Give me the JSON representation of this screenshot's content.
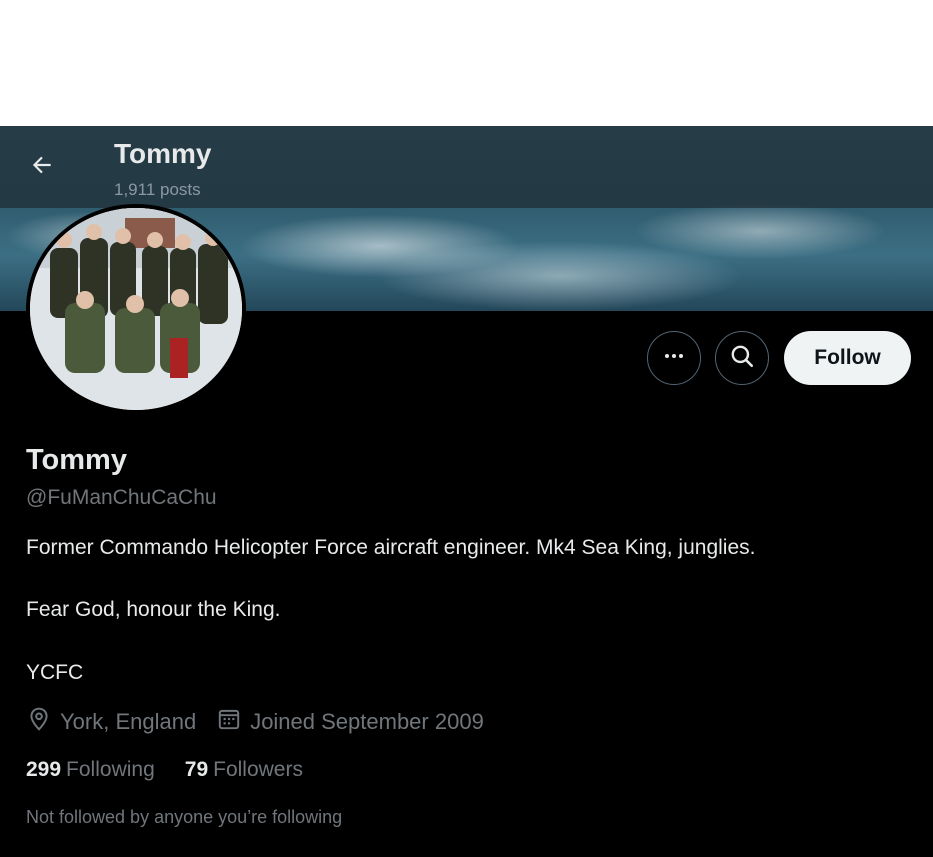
{
  "header": {
    "name": "Tommy",
    "posts_count": "1,911 posts"
  },
  "actions": {
    "follow_label": "Follow"
  },
  "profile": {
    "name": "Tommy",
    "handle": "@FuManChuCaChu",
    "bio_lines": [
      "Former Commando Helicopter Force aircraft engineer. Mk4 Sea King, junglies.",
      "Fear God, honour the King.",
      "YCFC"
    ],
    "location": "York, England",
    "joined": "Joined September 2009"
  },
  "stats": {
    "following_count": "299",
    "following_label": "Following",
    "followers_count": "79",
    "followers_label": "Followers"
  },
  "mutual_text": "Not followed by anyone you’re following",
  "icons": {
    "back": "arrow-left-icon",
    "more": "more-icon",
    "search": "search-icon",
    "location": "location-pin-icon",
    "calendar": "calendar-icon"
  },
  "colors": {
    "background": "#000000",
    "text_primary": "#e7e9ea",
    "text_secondary": "#71767b",
    "follow_button_bg": "#eff3f4"
  }
}
